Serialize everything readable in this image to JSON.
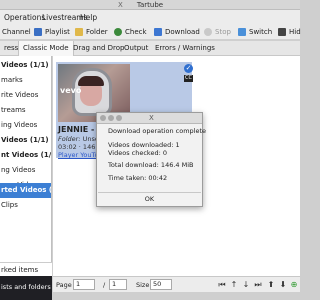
{
  "window": {
    "title": "Tartube"
  },
  "menubar": {
    "items": [
      "Operations",
      "Livestreams",
      "Help"
    ]
  },
  "toolbar": {
    "channel": "Channel",
    "playlist": "Playlist",
    "folder": "Folder",
    "check": "Check",
    "download": "Download",
    "stop": "Stop",
    "switch": "Switch",
    "hide": "Hid"
  },
  "tabs": [
    "ress",
    "Classic Mode",
    "Drag and Drop",
    "Output",
    "Errors / Warnings"
  ],
  "sidebar": {
    "items": [
      {
        "label": "Videos (1/1)",
        "bold": true
      },
      {
        "label": "marks",
        "bold": false
      },
      {
        "label": "rite Videos",
        "bold": false
      },
      {
        "label": "treams",
        "bold": false
      },
      {
        "label": "ing Videos",
        "bold": false
      },
      {
        "label": "Videos (1/1)",
        "bold": true
      },
      {
        "label": "nt Videos (1/1)",
        "bold": true
      },
      {
        "label": "ng Videos",
        "bold": false
      },
      {
        "label": "rary Videos",
        "bold": false
      },
      {
        "label": "rted Videos (1/1",
        "bold": true,
        "selected": true
      },
      {
        "label": "Clips",
        "bold": false
      }
    ],
    "bottom_label": "rked items",
    "footer_label": "ists and folders"
  },
  "video": {
    "title": "JENNIE -",
    "folder_label": "Folder:",
    "folder_value": "Unso",
    "meta": "03:02 · 146",
    "link": "Player YouTu",
    "thumb_logo": "vevo",
    "badge": "CC"
  },
  "dialog": {
    "heading": "Download operation complete",
    "videos_downloaded": "Videos downloaded: 1",
    "videos_checked": "Videos checked: 0",
    "total_download": "Total download: 146.4 MiB",
    "time_taken": "Time taken: 00:42",
    "ok": "OK"
  },
  "pager": {
    "page_label": "Page",
    "page_value": "1",
    "of_label": "/",
    "total_pages": "1",
    "size_label": "Size",
    "size_value": "50"
  },
  "colors": {
    "accent": "#3c7fd4",
    "card": "#b9c9e6",
    "link": "#2a56c8"
  }
}
